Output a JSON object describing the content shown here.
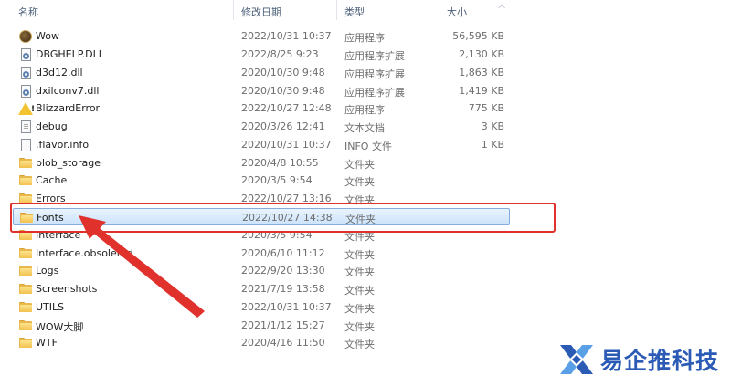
{
  "columns": {
    "name": "名称",
    "date": "修改日期",
    "type": "类型",
    "size": "大小"
  },
  "files": [
    {
      "name": "Wow",
      "date": "2022/10/31 10:37",
      "type": "应用程序",
      "size": "56,595 KB",
      "icon": "wow-app-icon"
    },
    {
      "name": "DBGHELP.DLL",
      "date": "2022/8/25 9:23",
      "type": "应用程序扩展",
      "size": "2,130 KB",
      "icon": "dll-file-icon"
    },
    {
      "name": "d3d12.dll",
      "date": "2020/10/30 9:48",
      "type": "应用程序扩展",
      "size": "1,863 KB",
      "icon": "dll-file-icon"
    },
    {
      "name": "dxilconv7.dll",
      "date": "2020/10/30 9:48",
      "type": "应用程序扩展",
      "size": "1,419 KB",
      "icon": "dll-file-icon"
    },
    {
      "name": "BlizzardError",
      "date": "2022/10/27 12:48",
      "type": "应用程序",
      "size": "775 KB",
      "icon": "warning-app-icon"
    },
    {
      "name": "debug",
      "date": "2020/3/26 12:41",
      "type": "文本文档",
      "size": "3 KB",
      "icon": "text-file-icon"
    },
    {
      "name": ".flavor.info",
      "date": "2020/10/31 10:37",
      "type": "INFO 文件",
      "size": "1 KB",
      "icon": "blank-file-icon"
    },
    {
      "name": "blob_storage",
      "date": "2020/4/8 10:55",
      "type": "文件夹",
      "size": "",
      "icon": "folder-icon"
    },
    {
      "name": "Cache",
      "date": "2020/3/5 9:54",
      "type": "文件夹",
      "size": "",
      "icon": "folder-icon"
    },
    {
      "name": "Errors",
      "date": "2022/10/27 13:16",
      "type": "文件夹",
      "size": "",
      "icon": "folder-icon"
    },
    {
      "name": "Fonts",
      "date": "2022/10/27 14:38",
      "type": "文件夹",
      "size": "",
      "icon": "folder-icon",
      "selected": true
    },
    {
      "name": "Interface",
      "date": "2020/3/5 9:54",
      "type": "文件夹",
      "size": "",
      "icon": "folder-icon"
    },
    {
      "name": "Interface.obsoleted",
      "date": "2020/6/10 11:12",
      "type": "文件夹",
      "size": "",
      "icon": "folder-icon"
    },
    {
      "name": "Logs",
      "date": "2022/9/20 13:30",
      "type": "文件夹",
      "size": "",
      "icon": "folder-icon"
    },
    {
      "name": "Screenshots",
      "date": "2021/7/19 13:58",
      "type": "文件夹",
      "size": "",
      "icon": "folder-icon"
    },
    {
      "name": "UTILS",
      "date": "2022/10/31 10:37",
      "type": "文件夹",
      "size": "",
      "icon": "folder-icon"
    },
    {
      "name": "WOW大脚",
      "date": "2021/1/12 15:27",
      "type": "文件夹",
      "size": "",
      "icon": "folder-icon"
    },
    {
      "name": "WTF",
      "date": "2020/4/16 11:50",
      "type": "文件夹",
      "size": "",
      "icon": "folder-icon"
    }
  ],
  "annotation": {
    "highlight_color": "#e0312c"
  },
  "watermark": {
    "text": "易企推科技",
    "color": "#2b5bb5"
  }
}
